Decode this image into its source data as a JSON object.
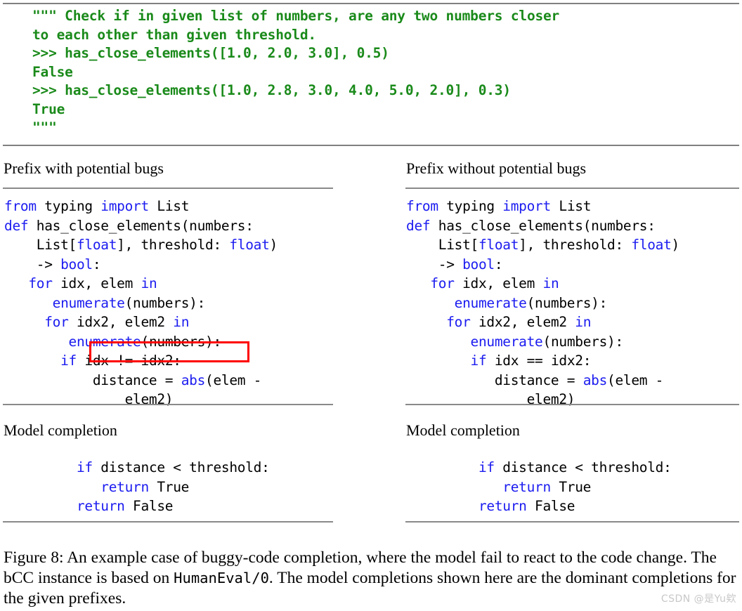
{
  "figure": {
    "docstring": {
      "lines": [
        "\"\"\" Check if in given list of numbers, are any two numbers closer",
        "to each other than given threshold.",
        ">>> has_close_elements([1.0, 2.0, 3.0], 0.5)",
        "False",
        ">>> has_close_elements([1.0, 2.8, 3.0, 4.0, 5.0, 2.0], 0.3)",
        "True",
        "\"\"\""
      ],
      "text": "\"\"\" Check if in given list of numbers, are any two numbers closer\nto each other than given threshold.\n>>> has_close_elements([1.0, 2.0, 3.0], 0.5)\nFalse\n>>> has_close_elements([1.0, 2.8, 3.0, 4.0, 5.0, 2.0], 0.3)\nTrue\n\"\"\"",
      "color": "#1a8a1a"
    },
    "columns": {
      "left": {
        "prefix_heading": "Prefix with potential bugs",
        "completion_heading": "Model completion",
        "prefix_code_lines": [
          "from typing import List",
          "def has_close_elements(numbers:",
          "    List[float], threshold: float)",
          "    -> bool:",
          "   for idx, elem in",
          "      enumerate(numbers):",
          "     for idx2, elem2 in",
          "        enumerate(numbers):",
          "       if idx != idx2:",
          "           distance = abs(elem -",
          "               elem2)"
        ],
        "completion_code_lines": [
          "         if distance < threshold:",
          "            return True",
          "         return False"
        ],
        "highlighted_line": "if idx != idx2:",
        "highlight_color": "#ff0000"
      },
      "right": {
        "prefix_heading": "Prefix without potential bugs",
        "completion_heading": "Model completion",
        "prefix_code_lines": [
          "from typing import List",
          "def has_close_elements(numbers:",
          "    List[float], threshold: float)",
          "    -> bool:",
          "   for idx, elem in",
          "      enumerate(numbers):",
          "     for idx2, elem2 in",
          "        enumerate(numbers):",
          "        if idx == idx2:",
          "           distance = abs(elem -",
          "               elem2)"
        ],
        "completion_code_lines": [
          "         if distance < threshold:",
          "            return True",
          "         return False"
        ],
        "highlighted_line": null,
        "highlight_color": null
      }
    },
    "syntax_colors": {
      "keyword": "#1c1cf0",
      "type": "#1c1cf0",
      "builtin": "#1c1cf0",
      "default": "#000000"
    },
    "caption": {
      "label": "Figure 8:",
      "part1": "Figure 8:  An example case of buggy-code completion, where the model fail to react to the code change. The bCC instance is based on ",
      "mono": "HumanEval/0",
      "part2": ". The model completions shown here are the dominant completions for the given prefixes."
    },
    "watermark": "CSDN @是Yu欸"
  }
}
